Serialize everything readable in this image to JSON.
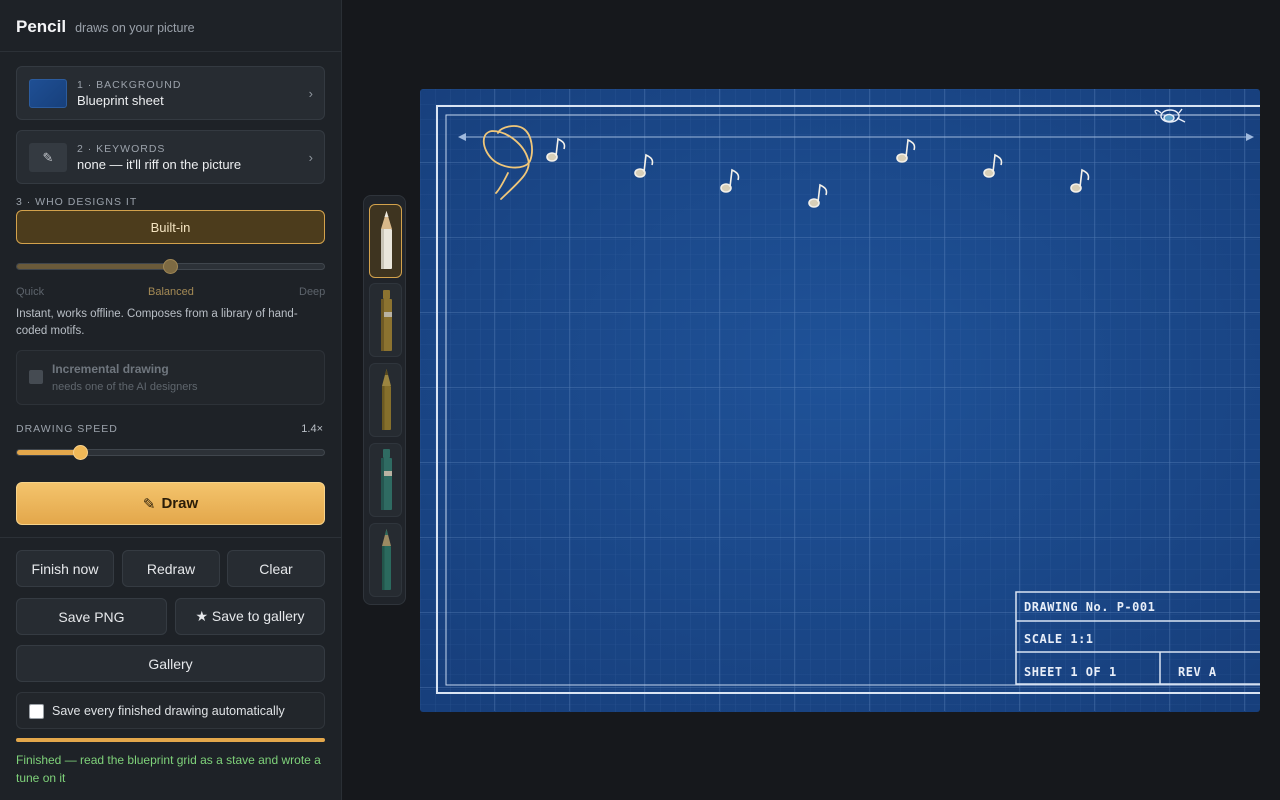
{
  "app": {
    "name": "Pencil",
    "tagline": "draws on your picture"
  },
  "background_card": {
    "step": "1 · BACKGROUND",
    "value": "Blueprint sheet",
    "chevron": "›"
  },
  "keywords_card": {
    "step": "2 · KEYWORDS",
    "value": "none — it'll riff on the picture",
    "chevron": "›",
    "icon": "pencil-icon"
  },
  "designer": {
    "label": "3 · WHO DESIGNS IT",
    "selected": "Built-in",
    "scale": [
      "Quick",
      "Balanced",
      "Deep"
    ],
    "active_scale": "Balanced",
    "level": 0.5,
    "description": "Instant, works offline. Composes from a library of hand-coded motifs."
  },
  "incremental": {
    "title": "Incremental drawing",
    "subtitle": "needs one of the AI designers",
    "enabled": false
  },
  "speed": {
    "label": "DRAWING SPEED",
    "value": "1.4×",
    "level": 0.21
  },
  "actions": {
    "draw": "Draw",
    "draw_icon": "pencil-icon",
    "finish_now": "Finish now",
    "redraw": "Redraw",
    "clear": "Clear",
    "save_png": "Save PNG",
    "save_gallery": "★ Save to gallery",
    "gallery": "Gallery"
  },
  "autosave": {
    "label": "Save every finished drawing automatically",
    "checked": false
  },
  "progress": 1.0,
  "status": "Finished — read the blueprint grid as a stave and wrote a tune on it",
  "pencils": [
    {
      "name": "white-pencil",
      "color": "#e9e6dc",
      "selected": true
    },
    {
      "name": "ochre-marker",
      "color": "#8c7330",
      "selected": false
    },
    {
      "name": "olive-pencil",
      "color": "#86702c",
      "selected": false
    },
    {
      "name": "teal-marker",
      "color": "#2f6b62",
      "selected": false
    },
    {
      "name": "teal-pencil",
      "color": "#2b6a5e",
      "selected": false
    }
  ],
  "title_block": {
    "drawing_no": "DRAWING No.  P-001",
    "scale": "SCALE  1:1",
    "sheet": "SHEET 1 OF 1",
    "rev": "REV  A"
  },
  "colors": {
    "blueprint": "#1b4a8e",
    "accent": "#e3a74b",
    "status_green": "#7fd27a"
  }
}
